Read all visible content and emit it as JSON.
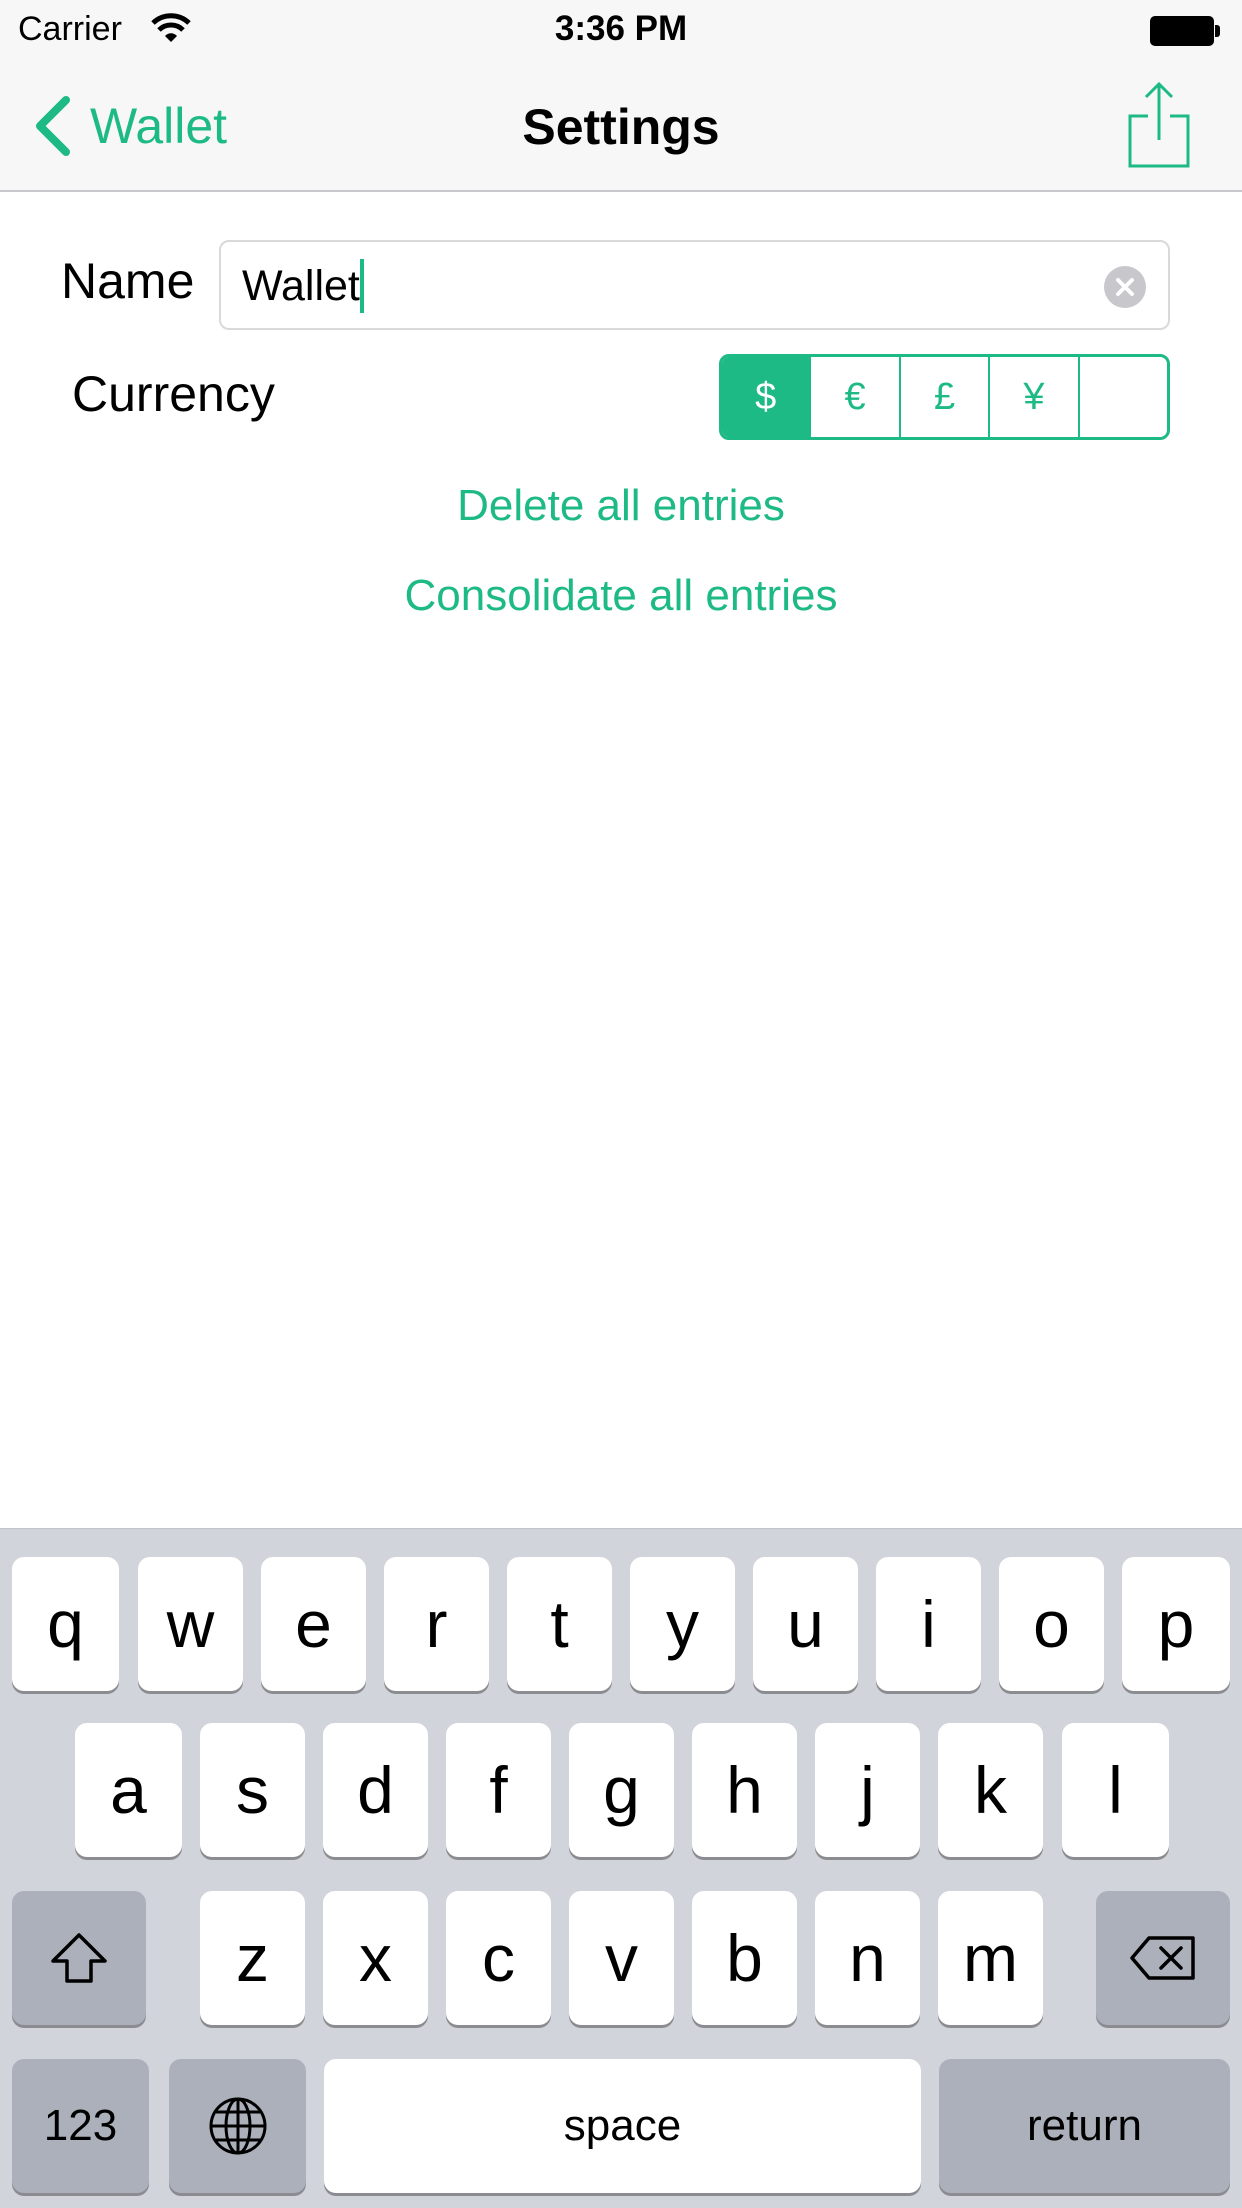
{
  "status_bar": {
    "carrier": "Carrier",
    "time": "3:36 PM"
  },
  "nav": {
    "back_label": "Wallet",
    "title": "Settings"
  },
  "form": {
    "name_label": "Name",
    "name_value": "Wallet",
    "currency_label": "Currency",
    "currencies": [
      "$",
      "€",
      "£",
      "¥",
      ""
    ],
    "selected_currency": "$"
  },
  "actions": {
    "delete_label": "Delete all entries",
    "consolidate_label": "Consolidate all entries"
  },
  "keyboard": {
    "row1": [
      "q",
      "w",
      "e",
      "r",
      "t",
      "y",
      "u",
      "i",
      "o",
      "p"
    ],
    "row2": [
      "a",
      "s",
      "d",
      "f",
      "g",
      "h",
      "j",
      "k",
      "l"
    ],
    "row3": [
      "z",
      "x",
      "c",
      "v",
      "b",
      "n",
      "m"
    ],
    "numbers_label": "123",
    "space_label": "space",
    "return_label": "return"
  },
  "colors": {
    "accent": "#1dba86",
    "nav_background": "#f7f7f7",
    "keyboard_background": "#d1d4da"
  }
}
